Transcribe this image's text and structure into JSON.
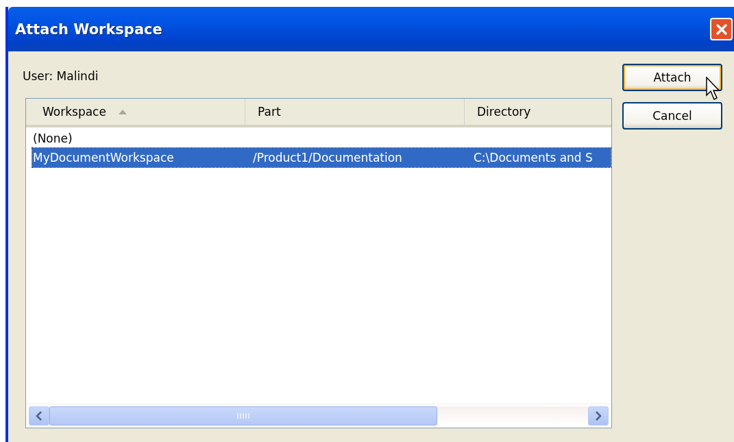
{
  "window": {
    "title": "Attach Workspace"
  },
  "user_label": "User: Malindi",
  "table": {
    "columns": [
      {
        "label": "Workspace",
        "sorted": true
      },
      {
        "label": "Part",
        "sorted": false
      },
      {
        "label": "Directory",
        "sorted": false
      }
    ],
    "rows": [
      {
        "cells": [
          "(None)",
          "",
          ""
        ],
        "selected": false
      },
      {
        "cells": [
          "MyDocumentWorkspace",
          "/Product1/Documentation",
          "C:\\Documents and S"
        ],
        "selected": true
      }
    ]
  },
  "buttons": [
    {
      "label": "Attach",
      "default": true
    },
    {
      "label": "Cancel",
      "default": false
    }
  ]
}
